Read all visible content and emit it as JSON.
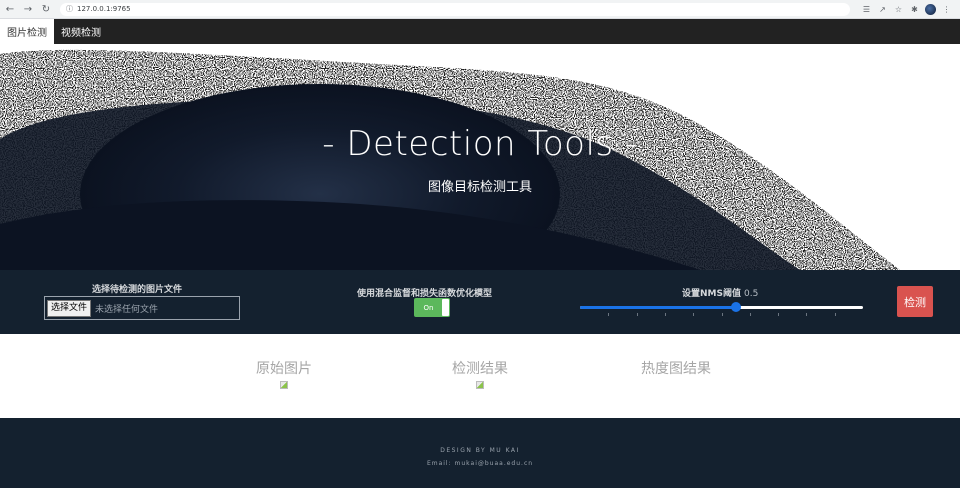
{
  "browser": {
    "url": "127.0.0.1:9765",
    "icons": [
      "back-icon",
      "forward-icon",
      "reload-icon",
      "lock-icon",
      "translate-icon",
      "share-icon",
      "star-icon",
      "extensions-icon",
      "profile-avatar",
      "menu-icon"
    ]
  },
  "navbar": {
    "tabs": [
      {
        "label": "图片检测",
        "active": true
      },
      {
        "label": "视频检测",
        "active": false
      }
    ]
  },
  "hero": {
    "title": "- Detection Tools -",
    "subtitle": "图像目标检测工具"
  },
  "controls": {
    "file_label": "选择待检测的图片文件",
    "file_button": "选择文件",
    "file_status": "未选择任何文件",
    "toggle_label": "使用混合监督和损失函数优化模型",
    "toggle_state": "On",
    "nms_label": "设置NMS阈值",
    "nms_value": "0.5",
    "nms_fraction": 0.55,
    "detect_button": "检测",
    "colors": {
      "detect": "#d9534f",
      "toggle_on": "#5cb85c",
      "slider": "#1a73e8"
    }
  },
  "results": {
    "columns": [
      "原始图片",
      "检测结果",
      "热度图结果"
    ]
  },
  "footer": {
    "credit": "DESIGN BY MU KAI",
    "email": "Email: mukai@buaa.edu.cn"
  }
}
